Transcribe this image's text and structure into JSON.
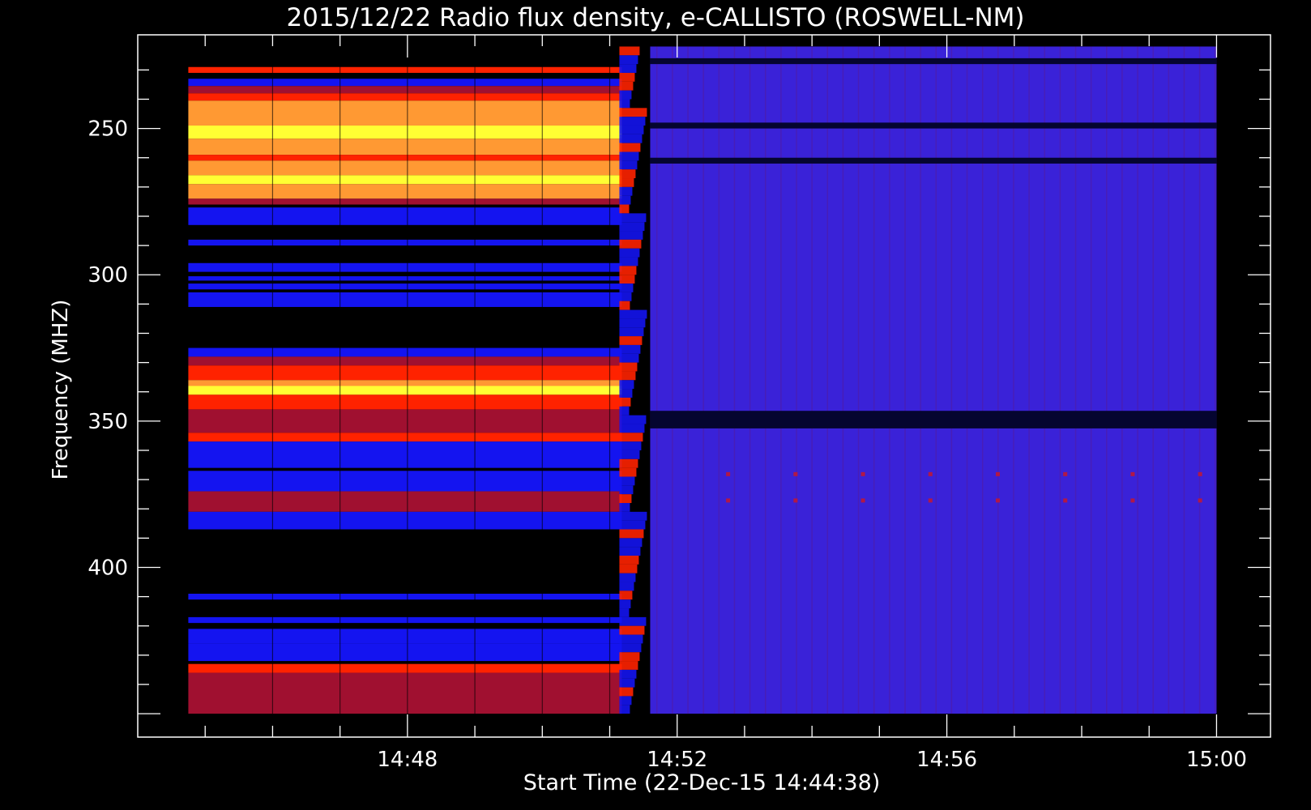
{
  "chart_data": {
    "type": "heatmap",
    "title": "2015/12/22  Radio flux density, e-CALLISTO (ROSWELL-NM)",
    "xlabel": "Start Time (22-Dec-15 14:44:38)",
    "ylabel": "Frequency (MHZ)",
    "x_ticks": [
      "14:48",
      "14:52",
      "14:56",
      "15:00"
    ],
    "y_ticks": [
      250,
      300,
      350,
      400
    ],
    "x_range_minutes": [
      44.0,
      60.8
    ],
    "y_range_mhz": [
      218,
      458
    ],
    "data_range_minutes": [
      44.75,
      60.0
    ],
    "data_range_mhz": [
      222,
      450
    ],
    "transition_minute": 51.6,
    "pre_bands": [
      {
        "f0": 229.0,
        "f1": 231.0,
        "level": 3
      },
      {
        "f0": 233.0,
        "f1": 235.5,
        "level": 1
      },
      {
        "f0": 235.5,
        "f1": 238.0,
        "level": 2
      },
      {
        "f0": 238.0,
        "f1": 240.5,
        "level": 3
      },
      {
        "f0": 240.5,
        "f1": 249.0,
        "level": 4
      },
      {
        "f0": 249.0,
        "f1": 253.5,
        "level": 5
      },
      {
        "f0": 253.5,
        "f1": 259.0,
        "level": 4
      },
      {
        "f0": 259.0,
        "f1": 261.0,
        "level": 3
      },
      {
        "f0": 261.0,
        "f1": 266.0,
        "level": 4
      },
      {
        "f0": 266.0,
        "f1": 269.0,
        "level": 5
      },
      {
        "f0": 269.0,
        "f1": 274.0,
        "level": 4
      },
      {
        "f0": 274.0,
        "f1": 276.0,
        "level": 2
      },
      {
        "f0": 277.0,
        "f1": 283.0,
        "level": 1
      },
      {
        "f0": 288.0,
        "f1": 290.0,
        "level": 1
      },
      {
        "f0": 296.0,
        "f1": 299.0,
        "level": 1
      },
      {
        "f0": 300.5,
        "f1": 302.0,
        "level": 1
      },
      {
        "f0": 303.0,
        "f1": 305.0,
        "level": 1
      },
      {
        "f0": 306.0,
        "f1": 311.0,
        "level": 1
      },
      {
        "f0": 325.0,
        "f1": 328.0,
        "level": 1
      },
      {
        "f0": 328.0,
        "f1": 331.0,
        "level": 2
      },
      {
        "f0": 331.0,
        "f1": 336.0,
        "level": 3
      },
      {
        "f0": 336.0,
        "f1": 338.0,
        "level": 4
      },
      {
        "f0": 338.0,
        "f1": 341.0,
        "level": 5
      },
      {
        "f0": 341.0,
        "f1": 346.0,
        "level": 3
      },
      {
        "f0": 346.0,
        "f1": 354.0,
        "level": 2
      },
      {
        "f0": 354.0,
        "f1": 357.0,
        "level": 3
      },
      {
        "f0": 357.0,
        "f1": 366.0,
        "level": 1
      },
      {
        "f0": 367.0,
        "f1": 374.0,
        "level": 1
      },
      {
        "f0": 374.0,
        "f1": 381.0,
        "level": 2
      },
      {
        "f0": 381.0,
        "f1": 387.0,
        "level": 1
      },
      {
        "f0": 409.0,
        "f1": 411.0,
        "level": 1
      },
      {
        "f0": 417.0,
        "f1": 419.0,
        "level": 1
      },
      {
        "f0": 421.0,
        "f1": 426.0,
        "level": 1
      },
      {
        "f0": 426.0,
        "f1": 432.0,
        "level": 1
      },
      {
        "f0": 433.0,
        "f1": 436.0,
        "level": 3
      },
      {
        "f0": 436.0,
        "f1": 450.0,
        "level": 2
      }
    ],
    "post_dark_bands": [
      {
        "f0": 226.0,
        "f1": 228.0
      },
      {
        "f0": 248.0,
        "f1": 250.0
      },
      {
        "f0": 260.0,
        "f1": 262.0
      },
      {
        "f0": 346.5,
        "f1": 352.5
      }
    ],
    "colors": [
      "#000000",
      "#1414f0",
      "#a01030",
      "#ff2200",
      "#ff9933",
      "#ffff33"
    ],
    "post_color": "#3a22d8",
    "post_dot_color": "#b01848"
  }
}
